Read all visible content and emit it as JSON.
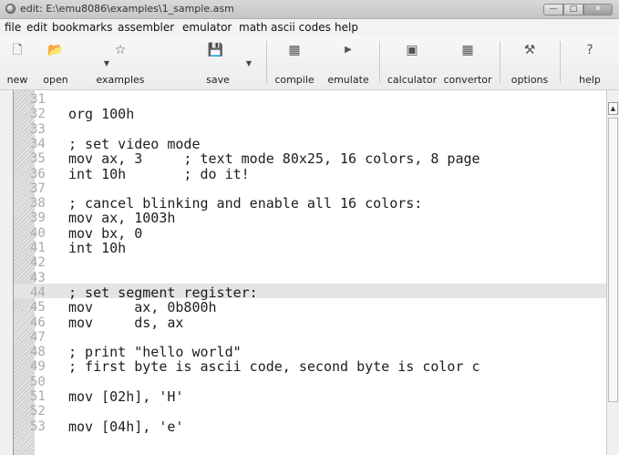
{
  "window": {
    "title": "edit: E:\\emu8086\\examples\\1_sample.asm",
    "controls": {
      "minimize": "—",
      "maximize": "□",
      "close": "✕"
    }
  },
  "menu": [
    "file",
    "edit",
    "bookmarks",
    "assembler",
    "emulator",
    "math",
    "ascii codes",
    "help"
  ],
  "toolbar": {
    "new": "new",
    "open": "open",
    "examples": "examples",
    "save": "save",
    "compile": "compile",
    "emulate": "emulate",
    "calculator": "calculator",
    "convertor": "convertor",
    "options": "options",
    "help": "help",
    "icons": {
      "new": "new-file-icon",
      "open": "open-folder-icon",
      "examples": "star-icon",
      "save": "floppy-disk-icon",
      "compile": "compile-icon",
      "emulate": "play-icon",
      "calculator": "calculator-icon",
      "convertor": "convertor-icon",
      "options": "tools-icon",
      "help": "help-icon"
    }
  },
  "editor": {
    "lines": [
      {
        "num": "31",
        "code": ""
      },
      {
        "num": "32",
        "code": "org 100h"
      },
      {
        "num": "33",
        "code": ""
      },
      {
        "num": "34",
        "code": "; set video mode"
      },
      {
        "num": "35",
        "code": "mov ax, 3     ; text mode 80x25, 16 colors, 8 page"
      },
      {
        "num": "36",
        "code": "int 10h       ; do it!"
      },
      {
        "num": "37",
        "code": ""
      },
      {
        "num": "38",
        "code": "; cancel blinking and enable all 16 colors:"
      },
      {
        "num": "39",
        "code": "mov ax, 1003h"
      },
      {
        "num": "40",
        "code": "mov bx, 0"
      },
      {
        "num": "41",
        "code": "int 10h"
      },
      {
        "num": "42",
        "code": ""
      },
      {
        "num": "43",
        "code": ""
      },
      {
        "num": "44",
        "code": "; set segment register:"
      },
      {
        "num": "45",
        "code": "mov     ax, 0b800h"
      },
      {
        "num": "46",
        "code": "mov     ds, ax"
      },
      {
        "num": "47",
        "code": ""
      },
      {
        "num": "48",
        "code": "; print \"hello world\""
      },
      {
        "num": "49",
        "code": "; first byte is ascii code, second byte is color c"
      },
      {
        "num": "50",
        "code": ""
      },
      {
        "num": "51",
        "code": "mov [02h], 'H'"
      },
      {
        "num": "52",
        "code": ""
      },
      {
        "num": "53",
        "code": "mov [04h], 'e'"
      }
    ]
  }
}
